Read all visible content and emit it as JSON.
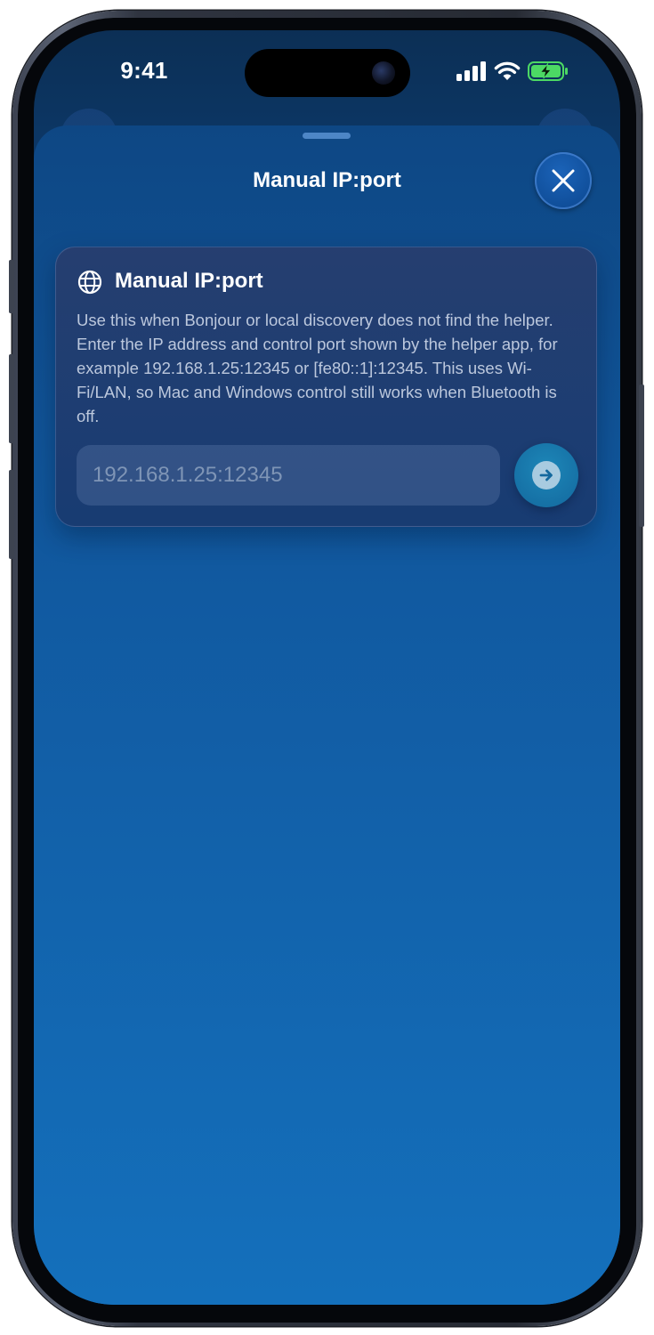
{
  "status_bar": {
    "time": "9:41",
    "battery_state": "charging",
    "battery_color": "#4cd964"
  },
  "sheet": {
    "title": "Manual IP:port",
    "close_icon": "close-icon"
  },
  "card": {
    "icon": "globe-icon",
    "title": "Manual IP:port",
    "description": "Use this when Bonjour or local discovery does not find the helper. Enter the IP address and control port shown by the helper app, for example 192.168.1.25:12345 or [fe80::1]:12345. This uses Wi-Fi/LAN, so Mac and Windows control still works when Bluetooth is off.",
    "input": {
      "value": "",
      "placeholder": "192.168.1.25:12345"
    },
    "submit_icon": "arrow-right-circle-icon"
  },
  "colors": {
    "background_top": "#0c2f55",
    "background_bottom": "#1470bd",
    "accent": "#1d87b8"
  }
}
